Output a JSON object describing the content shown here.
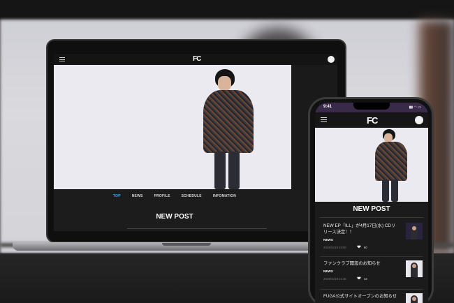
{
  "laptop": {
    "logo": "FC",
    "nav": [
      "TOP",
      "NEWS",
      "PROFILE",
      "SCHEDULE",
      "INFOMATION"
    ],
    "active_nav": "TOP",
    "section_title": "NEW POST"
  },
  "phone": {
    "status_time": "9:41",
    "status_icons": "▮▮ ◠ ▭",
    "logo": "FC",
    "section_title": "NEW POST",
    "posts": [
      {
        "title": "NEW EP「ILL」が4月17日(水) CDリリース決定！！",
        "tag": "NEWS",
        "date": "2024/01/19 22:00",
        "likes": "60",
        "heart": "❤"
      },
      {
        "title": "ファンクラブ開設のお知らせ",
        "tag": "NEWS",
        "date": "2024/01/19 21:45",
        "likes": "43",
        "heart": "❤"
      },
      {
        "title": "FUGA公式サイトオープンのお知らせ",
        "tag": "",
        "date": "",
        "likes": "",
        "heart": ""
      }
    ]
  },
  "colors": {
    "accent": "#29b6f6",
    "dark": "#1c1c1c",
    "hero_bg": "#eaeaf0"
  }
}
